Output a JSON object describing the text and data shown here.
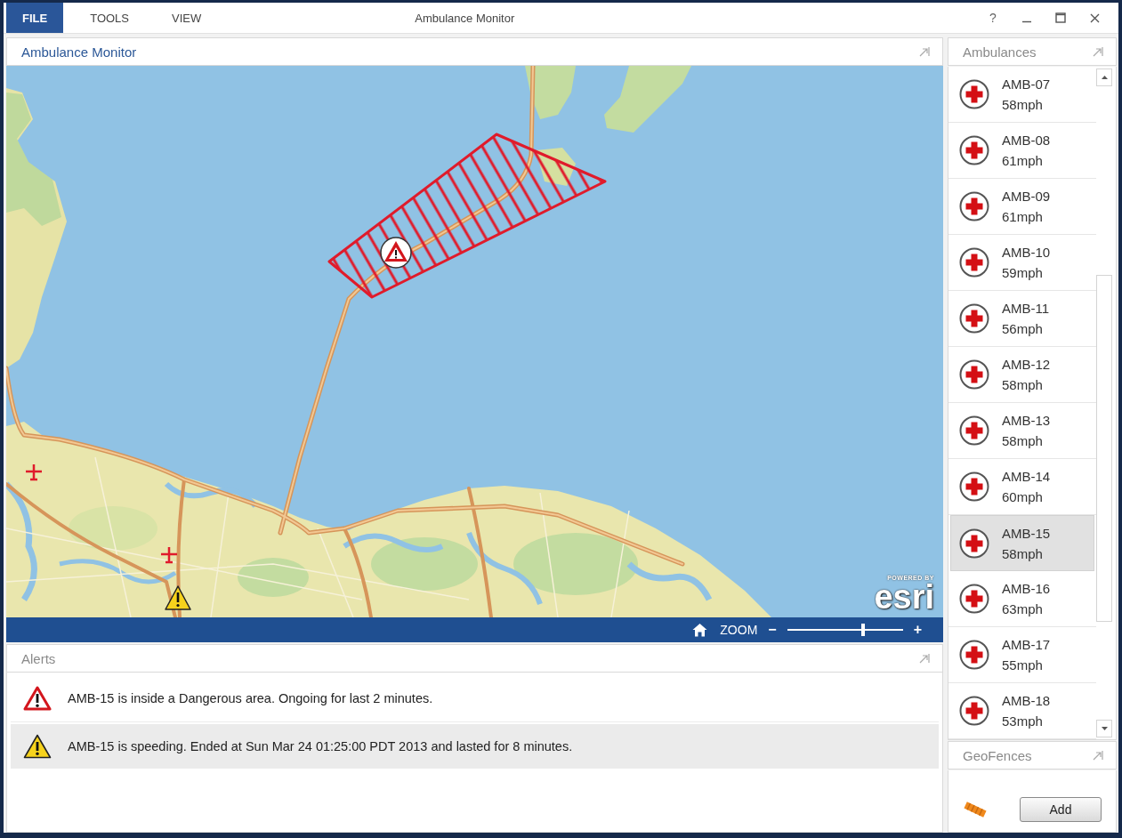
{
  "window": {
    "title": "Ambulance Monitor",
    "menu": [
      {
        "label": "FILE",
        "selected": true
      },
      {
        "label": "TOOLS",
        "selected": false
      },
      {
        "label": "VIEW",
        "selected": false
      }
    ],
    "help": "?"
  },
  "map_panel": {
    "title": "Ambulance Monitor",
    "attribution": {
      "caption": "POWERED BY",
      "logo": "esri"
    },
    "toolbar": {
      "zoom_label": "ZOOM",
      "zoom_out": "−",
      "zoom_in": "+",
      "level": 0.66
    }
  },
  "alerts": {
    "title": "Alerts",
    "items": [
      {
        "kind": "danger",
        "text": "AMB-15 is inside a Dangerous area. Ongoing for last 2 minutes.",
        "selected": false
      },
      {
        "kind": "warning",
        "text": "AMB-15 is speeding. Ended at Sun Mar 24 01:25:00 PDT 2013 and lasted for 8 minutes.",
        "selected": true
      }
    ]
  },
  "ambulances": {
    "title": "Ambulances",
    "items": [
      {
        "name": "AMB-07",
        "speed": "58mph",
        "selected": false
      },
      {
        "name": "AMB-08",
        "speed": "61mph",
        "selected": false
      },
      {
        "name": "AMB-09",
        "speed": "61mph",
        "selected": false
      },
      {
        "name": "AMB-10",
        "speed": "59mph",
        "selected": false
      },
      {
        "name": "AMB-11",
        "speed": "56mph",
        "selected": false
      },
      {
        "name": "AMB-12",
        "speed": "58mph",
        "selected": false
      },
      {
        "name": "AMB-13",
        "speed": "58mph",
        "selected": false
      },
      {
        "name": "AMB-14",
        "speed": "60mph",
        "selected": false
      },
      {
        "name": "AMB-15",
        "speed": "58mph",
        "selected": true
      },
      {
        "name": "AMB-16",
        "speed": "63mph",
        "selected": false
      },
      {
        "name": "AMB-17",
        "speed": "55mph",
        "selected": false
      },
      {
        "name": "AMB-18",
        "speed": "53mph",
        "selected": false
      }
    ]
  },
  "geofences": {
    "title": "GeoFences",
    "add_button": "Add"
  }
}
